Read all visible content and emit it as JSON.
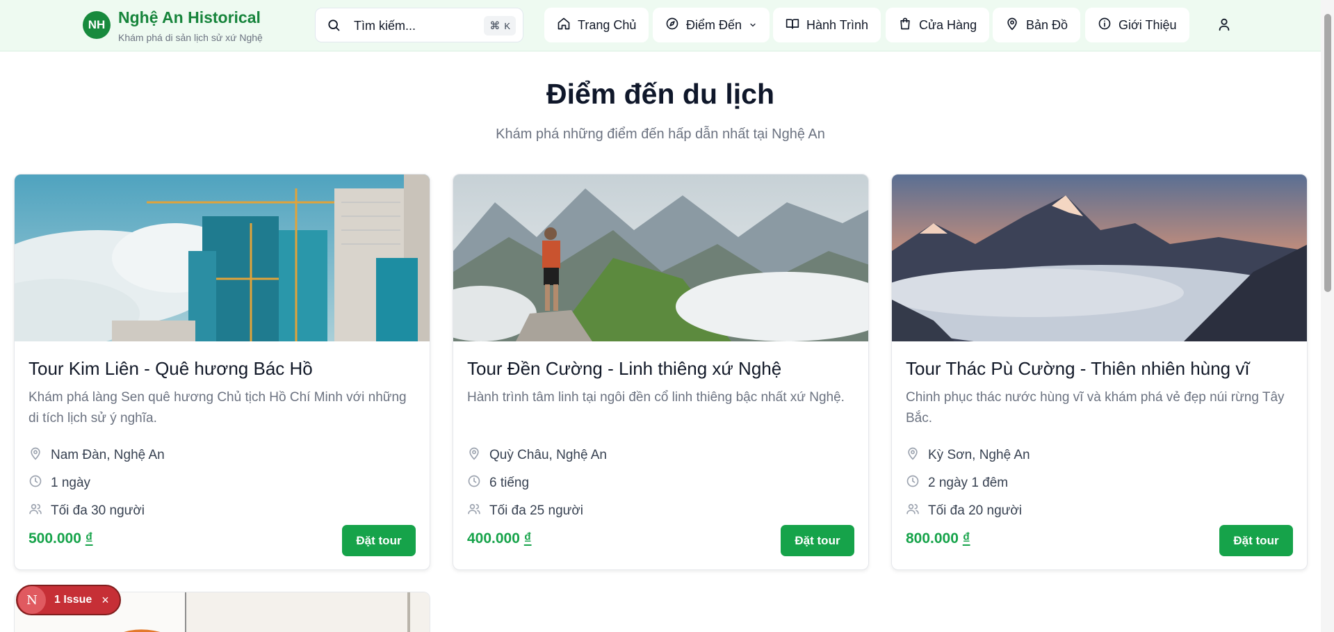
{
  "header": {
    "logo_initials": "NH",
    "brand_title": "Nghệ An Historical",
    "brand_subtitle": "Khám phá di sản lịch sử xứ Nghệ",
    "search_placeholder": "Tìm kiếm...",
    "search_shortcut_symbol": "⌘",
    "search_shortcut_key": "K",
    "nav": [
      {
        "label": "Trang Chủ",
        "icon": "home-icon"
      },
      {
        "label": "Điểm Đến",
        "icon": "compass-icon"
      },
      {
        "label": "Hành Trình",
        "icon": "book-open-icon"
      },
      {
        "label": "Cửa Hàng",
        "icon": "shopping-bag-icon"
      },
      {
        "label": "Bản Đồ",
        "icon": "map-pin-icon"
      },
      {
        "label": "Giới Thiệu",
        "icon": "info-icon"
      }
    ]
  },
  "hero": {
    "title": "Điểm đến du lịch",
    "subtitle": "Khám phá những điểm đến hấp dẫn nhất tại Nghệ An"
  },
  "cards": [
    {
      "title": "Tour Kim Liên - Quê hương Bác Hồ",
      "description": "Khám phá làng Sen quê hương Chủ tịch Hồ Chí Minh với những di tích lịch sử ý nghĩa.",
      "location": "Nam Đàn, Nghệ An",
      "duration": "1 ngày",
      "capacity": "Tối đa 30 người",
      "price": "500.000",
      "currency": "₫",
      "button": "Đặt tour"
    },
    {
      "title": "Tour Đền Cường - Linh thiêng xứ Nghệ",
      "description": "Hành trình tâm linh tại ngôi đền cổ linh thiêng bậc nhất xứ Nghệ.",
      "location": "Quỳ Châu, Nghệ An",
      "duration": "6 tiếng",
      "capacity": "Tối đa 25 người",
      "price": "400.000",
      "currency": "₫",
      "button": "Đặt tour"
    },
    {
      "title": "Tour Thác Pù Cường - Thiên nhiên hùng vĩ",
      "description": "Chinh phục thác nước hùng vĩ và khám phá vẻ đẹp núi rừng Tây Bắc.",
      "location": "Kỳ Sơn, Nghệ An",
      "duration": "2 ngày 1 đêm",
      "capacity": "Tối đa 20 người",
      "price": "800.000",
      "currency": "₫",
      "button": "Đặt tour"
    }
  ],
  "issue_badge": {
    "letter": "N",
    "label": "1 Issue",
    "close": "×"
  },
  "colors": {
    "brand_green": "#16843b",
    "price_green": "#16a34a",
    "header_bg": "#eefaf1",
    "issue_red": "#c62f36"
  }
}
